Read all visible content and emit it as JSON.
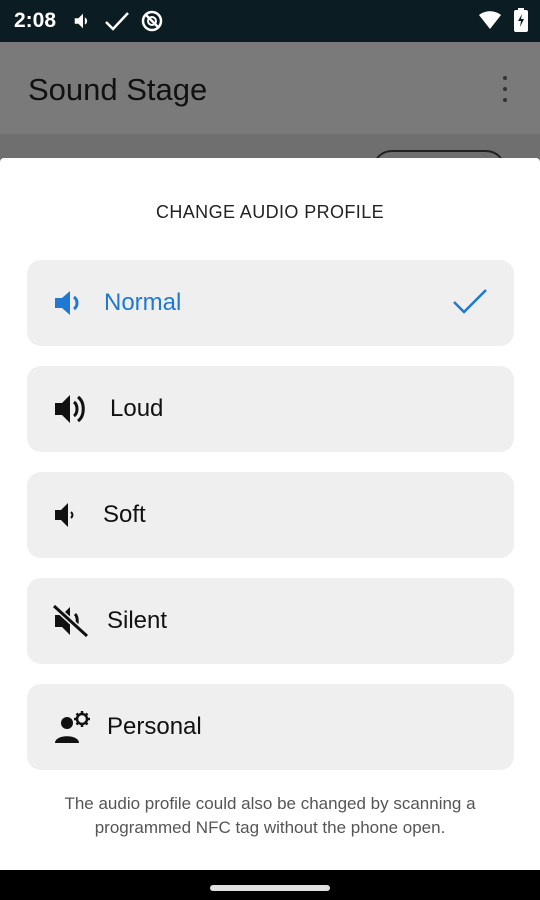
{
  "status_bar": {
    "time": "2:08",
    "left_icons": [
      "volume-icon",
      "check-icon",
      "no-sync-icon"
    ],
    "right_icons": [
      "wifi-icon",
      "battery-icon"
    ]
  },
  "app_bar": {
    "title": "Sound Stage",
    "overflow_icon": "more-vert-icon"
  },
  "sheet": {
    "title": "CHANGE AUDIO PROFILE",
    "options": [
      {
        "label": "Normal",
        "icon": "volume-normal-icon",
        "selected": true
      },
      {
        "label": "Loud",
        "icon": "volume-loud-icon",
        "selected": false
      },
      {
        "label": "Soft",
        "icon": "volume-soft-icon",
        "selected": false
      },
      {
        "label": "Silent",
        "icon": "volume-off-icon",
        "selected": false
      },
      {
        "label": "Personal",
        "icon": "person-settings-icon",
        "selected": false
      }
    ],
    "footnote": "The audio profile could also be changed by scanning a programmed NFC tag without the phone open."
  },
  "colors": {
    "accent": "#1f78d1",
    "option_bg": "#efefef",
    "status_bar_bg": "#0b1d22"
  }
}
